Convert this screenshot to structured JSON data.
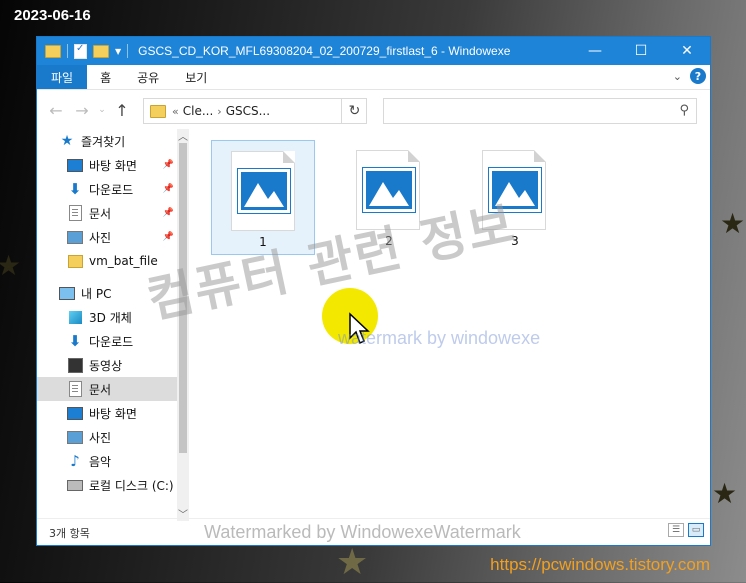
{
  "overlay": {
    "date": "2023-06-16",
    "site": "https://pcwindows.tistory.com",
    "watermark_big": "컴퓨터 관련 정보",
    "watermark_small": "watermark by windowexe",
    "watermark_bottom": "Watermarked by WindowexeWatermark"
  },
  "window": {
    "title": "GSCS_CD_KOR_MFL69308204_02_200729_firstlast_6  - Windowexe",
    "controls": {
      "minimize": "—",
      "maximize": "☐",
      "close": "✕"
    }
  },
  "ribbon": {
    "tabs": [
      "파일",
      "홈",
      "공유",
      "보기"
    ],
    "help": "?"
  },
  "address": {
    "crumb_prefix": "«",
    "crumbs": [
      "Cle...",
      "GSCS..."
    ],
    "separator": "›"
  },
  "search": {
    "placeholder": ""
  },
  "nav_pane": {
    "items": [
      {
        "label": "즐겨찾기",
        "icon": "star-icon",
        "pinned": false
      },
      {
        "label": "바탕 화면",
        "icon": "desktop-icon",
        "pinned": true
      },
      {
        "label": "다운로드",
        "icon": "download-icon",
        "pinned": true
      },
      {
        "label": "문서",
        "icon": "document-icon",
        "pinned": true
      },
      {
        "label": "사진",
        "icon": "pictures-icon",
        "pinned": true
      },
      {
        "label": "vm_bat_file",
        "icon": "folder-icon",
        "pinned": false
      },
      {
        "label": "내 PC",
        "icon": "pc-icon",
        "pinned": false
      },
      {
        "label": "3D 개체",
        "icon": "3d-objects-icon",
        "pinned": false
      },
      {
        "label": "다운로드",
        "icon": "download-icon",
        "pinned": false
      },
      {
        "label": "동영상",
        "icon": "video-icon",
        "pinned": false
      },
      {
        "label": "문서",
        "icon": "document-icon",
        "pinned": false,
        "selected": true
      },
      {
        "label": "바탕 화면",
        "icon": "desktop-icon",
        "pinned": false
      },
      {
        "label": "사진",
        "icon": "pictures-icon",
        "pinned": false
      },
      {
        "label": "음악",
        "icon": "music-icon",
        "pinned": false
      },
      {
        "label": "로컬 디스크 (C:)",
        "icon": "drive-icon",
        "pinned": false
      }
    ]
  },
  "files": [
    {
      "name": "1",
      "selected": true
    },
    {
      "name": "2",
      "selected": false
    },
    {
      "name": "3",
      "selected": false
    }
  ],
  "status": {
    "count": "3개 항목"
  },
  "colors": {
    "accent": "#1979ca",
    "titlebar": "#1e84d8",
    "site_link": "#f2a020"
  }
}
